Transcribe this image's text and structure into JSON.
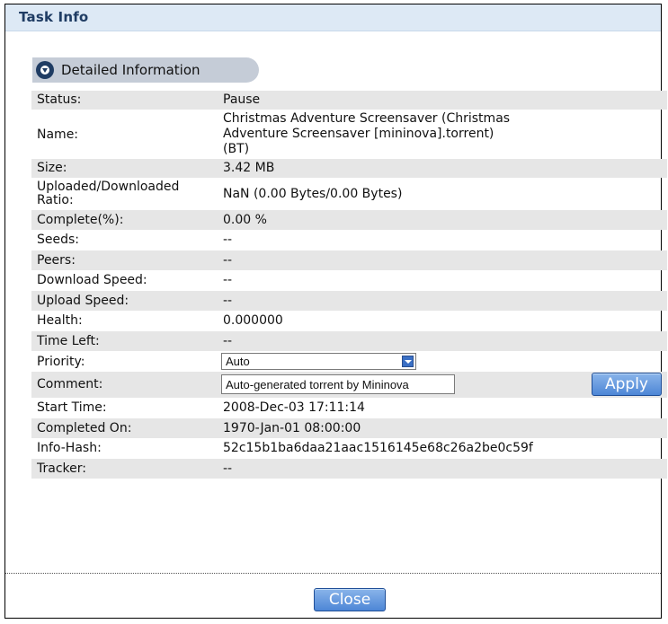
{
  "window": {
    "title": "Task Info"
  },
  "section": {
    "label": "Detailed Information"
  },
  "rows": [
    {
      "label": "Status:",
      "value": "Pause"
    },
    {
      "label": "Name:",
      "value_lines": [
        "Christmas Adventure Screensaver (Christmas",
        "Adventure Screensaver [mininova].torrent)",
        "(BT)"
      ]
    },
    {
      "label": "Size:",
      "value": "3.42 MB"
    },
    {
      "label_lines": [
        "Uploaded/Downloaded",
        "Ratio:"
      ],
      "value": "NaN (0.00 Bytes/0.00 Bytes)"
    },
    {
      "label": "Complete(%):",
      "value": "0.00 %"
    },
    {
      "label": "Seeds:",
      "value": "--"
    },
    {
      "label": "Peers:",
      "value": "--"
    },
    {
      "label": "Download Speed:",
      "value": "--"
    },
    {
      "label": "Upload Speed:",
      "value": "--"
    },
    {
      "label": "Health:",
      "value": "0.000000"
    },
    {
      "label": "Time Left:",
      "value": "--"
    },
    {
      "label": "Priority:",
      "selected": "Auto"
    },
    {
      "label": "Comment:",
      "input_value": "Auto-generated torrent by Mininova",
      "button": "Apply"
    },
    {
      "label": "Start Time:",
      "value": "2008-Dec-03 17:11:14"
    },
    {
      "label": "Completed On:",
      "value": "1970-Jan-01 08:00:00"
    },
    {
      "label": "Info-Hash:",
      "value": "52c15b1ba6daa21aac1516145e68c26a2be0c59f"
    },
    {
      "label": "Tracker:",
      "value": "--"
    }
  ],
  "footer": {
    "close_label": "Close"
  },
  "colors": {
    "title_bg": "#dde9f5",
    "title_text": "#1f3c63",
    "row_shade": "#e6e6e6",
    "button": "#4d86d6"
  }
}
